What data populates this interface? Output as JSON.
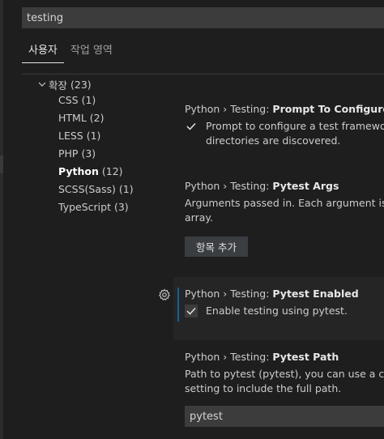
{
  "search": {
    "value": "testing"
  },
  "tabs": [
    {
      "label": "사용자"
    },
    {
      "label": "작업 영역"
    }
  ],
  "toc": {
    "group": {
      "label": "확장",
      "count": "(23)"
    },
    "items": [
      {
        "name": "CSS",
        "count": "(1)"
      },
      {
        "name": "HTML",
        "count": "(2)"
      },
      {
        "name": "LESS",
        "count": "(1)"
      },
      {
        "name": "PHP",
        "count": "(3)"
      },
      {
        "name": "Python",
        "count": "(12)"
      },
      {
        "name": "SCSS(Sass)",
        "count": "(1)"
      },
      {
        "name": "TypeScript",
        "count": "(3)"
      }
    ]
  },
  "settings": {
    "prompt_to_configure": {
      "category": "Python › Testing: ",
      "name": "Prompt To Configure",
      "desc_line1": "Prompt to configure a test framework",
      "desc_line2": "directories are discovered.",
      "checked": true
    },
    "pytest_args": {
      "category": "Python › Testing: ",
      "name": "Pytest Args",
      "desc_line1": "Arguments passed in. Each argument is a se",
      "desc_line2": "array.",
      "add_label": "항목 추가"
    },
    "pytest_enabled": {
      "category": "Python › Testing: ",
      "name": "Pytest Enabled",
      "desc": "Enable testing using pytest.",
      "checked": true
    },
    "pytest_path": {
      "category": "Python › Testing: ",
      "name": "Pytest Path",
      "desc_line1": "Path to pytest (pytest), you can use a custo",
      "desc_line2": "setting to include the full path.",
      "value": "pytest"
    }
  },
  "icons": {
    "expand": "chevron-down-icon",
    "settings": "gear-icon",
    "check": "checkmark-icon"
  },
  "colors": {
    "background": "#1e1e1e",
    "focus_bar": "#0e639c",
    "input_bg": "#3c3c3c"
  }
}
